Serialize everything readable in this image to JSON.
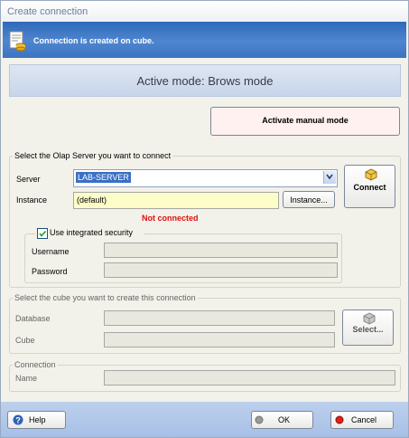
{
  "window": {
    "title": "Create connection"
  },
  "info": {
    "message": "Connection is created on cube."
  },
  "mode": {
    "label": "Active mode: Brows mode"
  },
  "actions": {
    "activate_manual": "Activate manual mode"
  },
  "server_group": {
    "legend": "Select the Olap Server you want to connect",
    "server_label": "Server",
    "server_value": "LAB-SERVER",
    "instance_label": "Instance",
    "instance_value": "(default)",
    "instance_button": "Instance...",
    "connect_button": "Connect",
    "status": "Not connected"
  },
  "security": {
    "checkbox_label": "Use integrated security",
    "checked": true,
    "username_label": "Username",
    "password_label": "Password"
  },
  "cube_group": {
    "legend": "Select the cube you want to create this connection",
    "database_label": "Database",
    "cube_label": "Cube",
    "select_button": "Select..."
  },
  "connection_group": {
    "legend": "Connection",
    "name_label": "Name"
  },
  "footer": {
    "help": "Help",
    "ok": "OK",
    "cancel": "Cancel"
  },
  "colors": {
    "info_bar": "#3c74c3",
    "status_error": "#e01010",
    "instance_field_bg": "#fdfdc9",
    "footer_bg": "#a7c0e6"
  }
}
